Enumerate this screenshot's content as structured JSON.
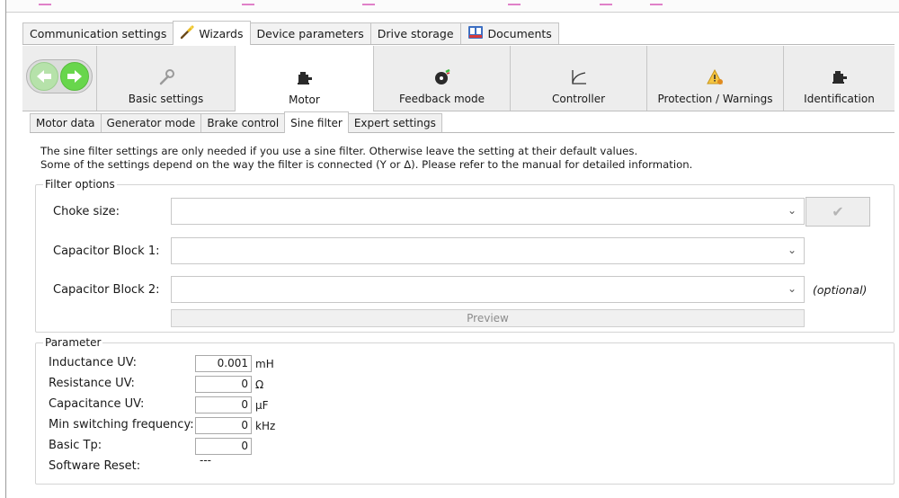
{
  "main_tabs": [
    {
      "label": "Communication settings",
      "icon": "",
      "active": false
    },
    {
      "label": "Wizards",
      "icon": "wand-icon",
      "active": true
    },
    {
      "label": "Device parameters",
      "icon": "",
      "active": false
    },
    {
      "label": "Drive storage",
      "icon": "",
      "active": false
    },
    {
      "label": "Documents",
      "icon": "book-icon",
      "active": false
    }
  ],
  "wizard_steps": [
    {
      "label": "Basic settings",
      "icon": "wrench-icon"
    },
    {
      "label": "Motor",
      "icon": "motor-icon"
    },
    {
      "label": "Feedback mode",
      "icon": "encoder-icon"
    },
    {
      "label": "Controller",
      "icon": "curve-icon"
    },
    {
      "label": "Protection / Warnings",
      "icon": "warning-icon"
    },
    {
      "label": "Identification",
      "icon": "motor-icon"
    }
  ],
  "sub_tabs": [
    {
      "label": "Motor data"
    },
    {
      "label": "Generator mode"
    },
    {
      "label": "Brake control"
    },
    {
      "label": "Sine filter"
    },
    {
      "label": "Expert settings"
    }
  ],
  "info": {
    "line1": "The sine filter settings are only needed if you use a sine filter. Otherwise leave the setting at their default values.",
    "line2": "Some of the settings depend on the way the filter is connected (Y or Δ). Please refer to the manual for detailed information."
  },
  "filter_options": {
    "title": "Filter options",
    "choke_label": "Choke size:",
    "choke_value": "",
    "cap1_label": "Capacitor Block 1:",
    "cap1_value": "",
    "cap2_label": "Capacitor Block 2:",
    "cap2_value": "",
    "optional": "(optional)",
    "preview": "Preview",
    "apply_icon": "checkmark-icon"
  },
  "parameter": {
    "title": "Parameter",
    "rows": [
      {
        "label": "Inductance UV:",
        "value": "0.001",
        "unit": "mH"
      },
      {
        "label": "Resistance UV:",
        "value": "0",
        "unit": "Ω"
      },
      {
        "label": "Capacitance UV:",
        "value": "0",
        "unit": "µF"
      },
      {
        "label": "Min switching frequency:",
        "value": "0",
        "unit": "kHz"
      },
      {
        "label": "Basic Tp:",
        "value": "0",
        "unit": ""
      }
    ],
    "software_reset_label": "Software Reset:",
    "software_reset_value": "---"
  },
  "colors": {
    "nav_green": "#68d64c",
    "warning_orange": "#f0a020"
  }
}
